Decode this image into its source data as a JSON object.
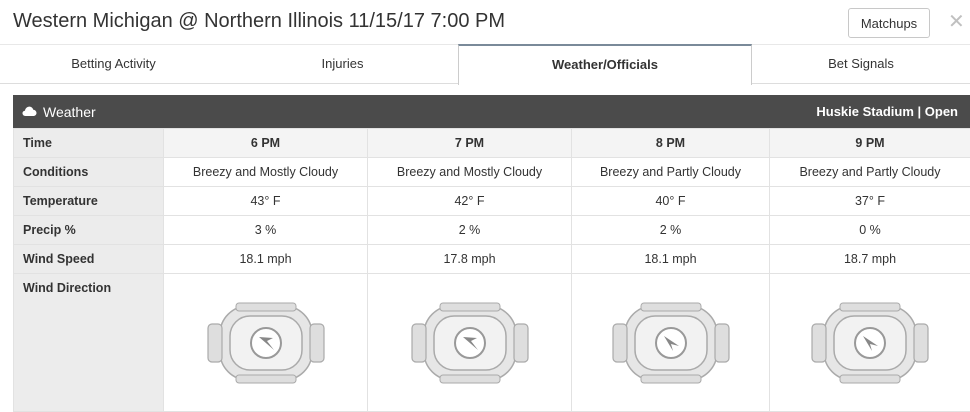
{
  "header": {
    "title": "Western Michigan @ Northern Illinois 11/15/17 7:00 PM",
    "matchups_label": "Matchups",
    "close_glyph": "✕"
  },
  "tabs": [
    {
      "label": "Betting Activity",
      "active": false
    },
    {
      "label": "Injuries",
      "active": false
    },
    {
      "label": "Weather/Officials",
      "active": true
    },
    {
      "label": "Bet Signals",
      "active": false
    }
  ],
  "weather": {
    "title": "Weather",
    "icon": "cloud-icon",
    "venue": "Huskie Stadium | Open",
    "row_labels": {
      "time": "Time",
      "conditions": "Conditions",
      "temperature": "Temperature",
      "precip": "Precip %",
      "wind_speed": "Wind Speed",
      "wind_direction": "Wind Direction"
    },
    "hours": [
      {
        "time": "6 PM",
        "conditions": "Breezy and Mostly Cloudy",
        "temperature": "43° F",
        "precip": "3 %",
        "wind_speed": "18.1 mph",
        "wind_icon": "stadium-wind-arrow-icon"
      },
      {
        "time": "7 PM",
        "conditions": "Breezy and Mostly Cloudy",
        "temperature": "42° F",
        "precip": "2 %",
        "wind_speed": "17.8 mph",
        "wind_icon": "stadium-wind-arrow-icon"
      },
      {
        "time": "8 PM",
        "conditions": "Breezy and Partly Cloudy",
        "temperature": "40° F",
        "precip": "2 %",
        "wind_speed": "18.1 mph",
        "wind_icon": "stadium-wind-arrow-icon"
      },
      {
        "time": "9 PM",
        "conditions": "Breezy and Partly Cloudy",
        "temperature": "37° F",
        "precip": "0 %",
        "wind_speed": "18.7 mph",
        "wind_icon": "stadium-wind-arrow-icon"
      }
    ]
  },
  "colors": {
    "panel_header": "#4b4b4b",
    "label_column": "#ececec",
    "active_tab_border": "#7a8a99"
  }
}
